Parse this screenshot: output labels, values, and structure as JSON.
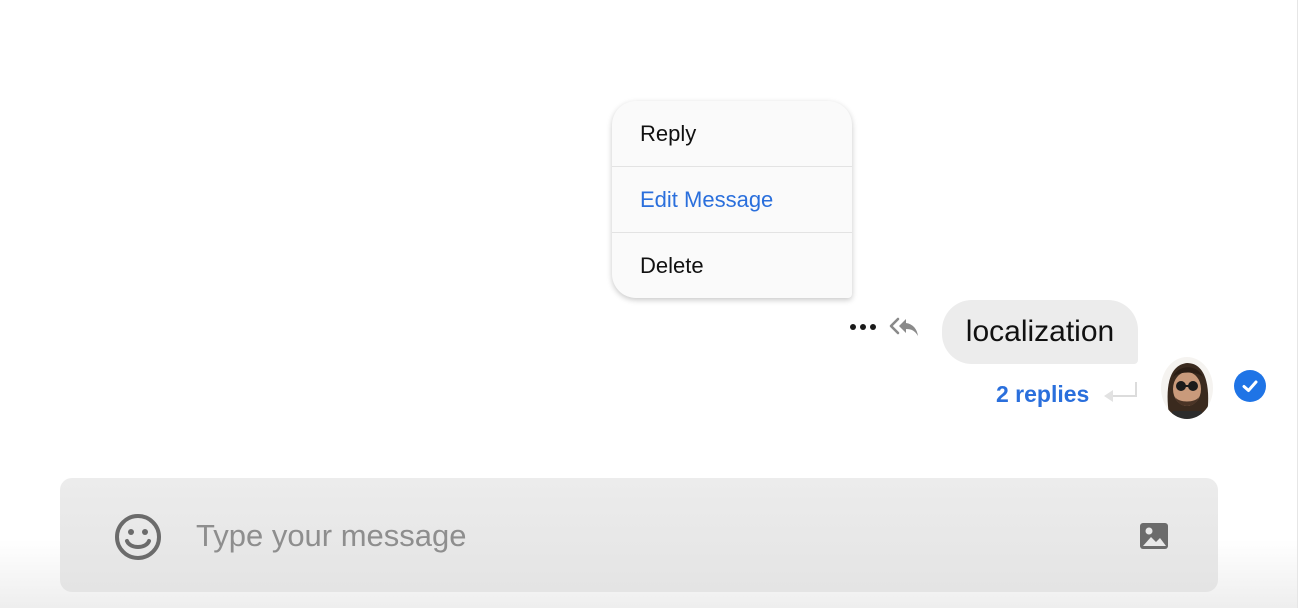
{
  "context_menu": {
    "items": [
      {
        "label": "Reply",
        "style": "default"
      },
      {
        "label": "Edit Message",
        "style": "accent"
      },
      {
        "label": "Delete",
        "style": "default"
      }
    ]
  },
  "message": {
    "text": "localization",
    "replies_label": "2 replies",
    "status": "read"
  },
  "composer": {
    "placeholder": "Type your message",
    "value": ""
  },
  "colors": {
    "accent": "#2a6fdc",
    "bubble": "#ececec",
    "read_badge": "#1f74e6"
  },
  "icons": {
    "more": "more-dots-icon",
    "reply_all": "reply-all-icon",
    "return": "return-arrow-icon",
    "read": "checkmark-circle-icon",
    "emoji": "smiley-icon",
    "image": "image-icon"
  }
}
